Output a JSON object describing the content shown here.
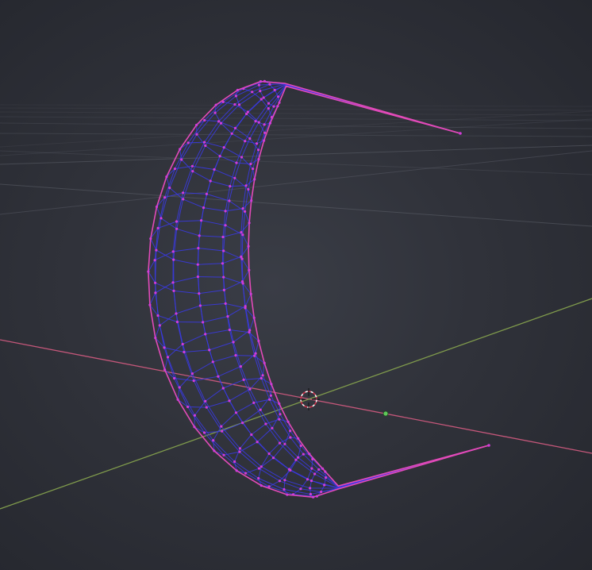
{
  "viewport": {
    "mode": "edit-mode-wireframe",
    "object": "crescent-mesh",
    "colors": {
      "background": "#2b2d34",
      "grid": "#5d606a",
      "x_axis": "#c4577a",
      "y_axis": "#7f9a4c",
      "wire": "#3a3ae8",
      "vertex": "#d23cd8",
      "seam": "#e24ab8",
      "cursor": "#ffffff"
    },
    "icons": [
      "3d-cursor-icon",
      "origin-point-icon"
    ]
  }
}
